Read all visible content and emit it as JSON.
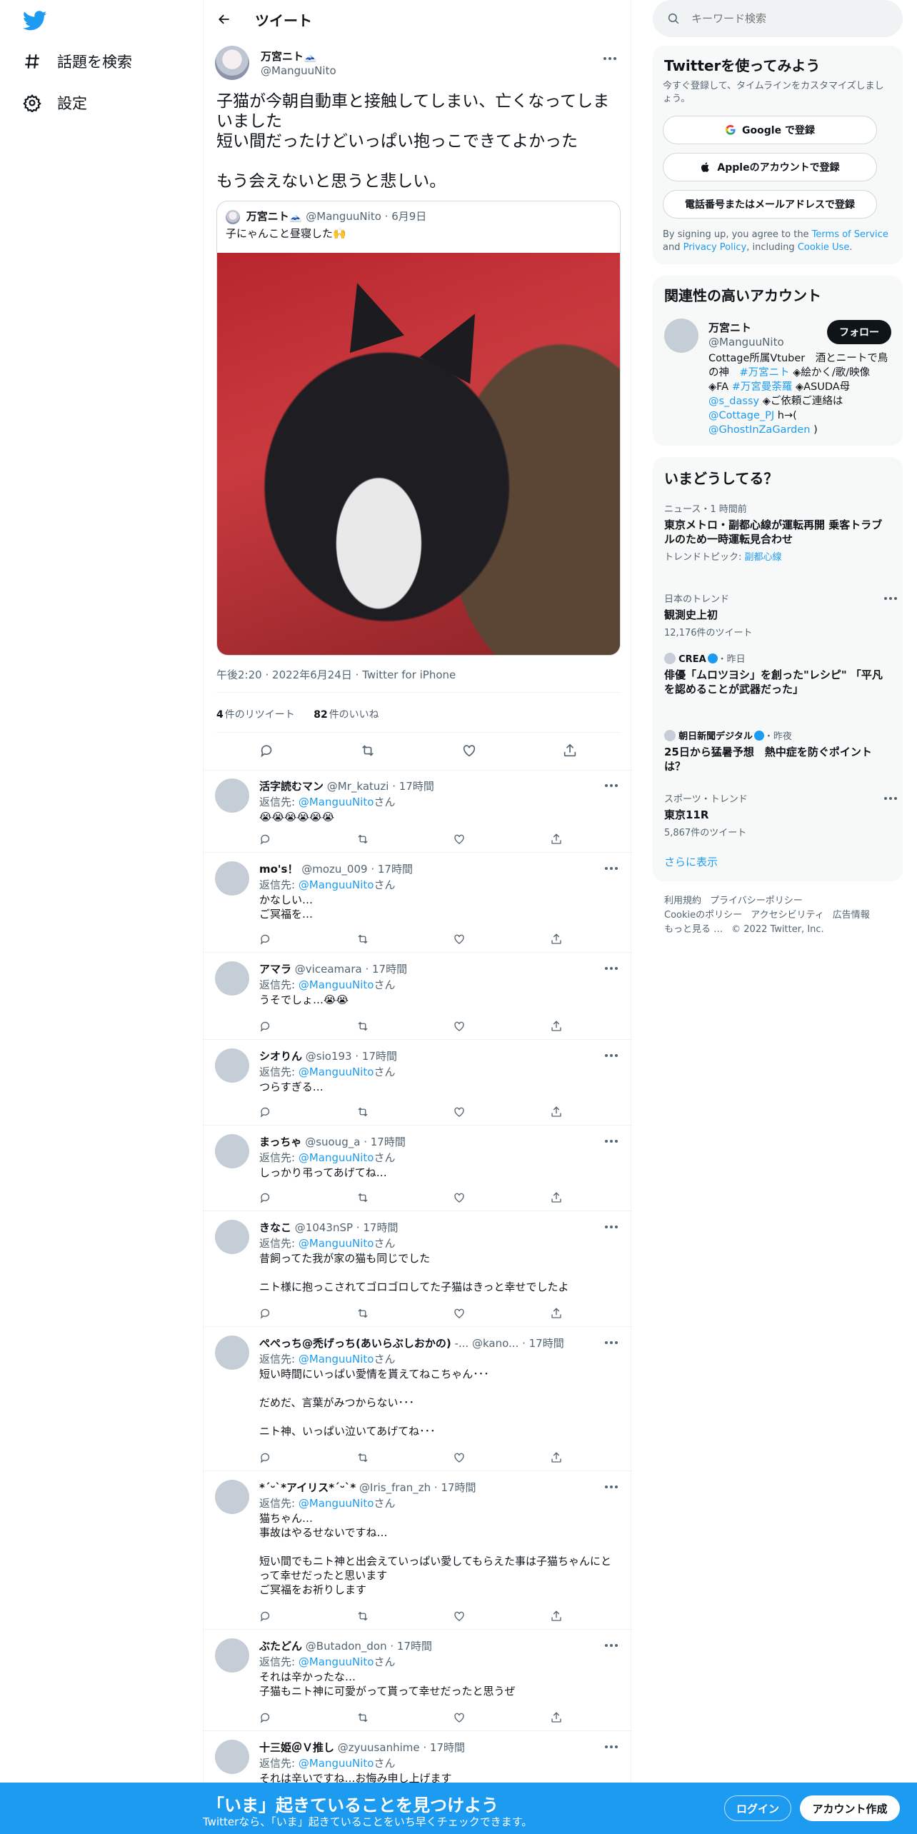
{
  "nav": {
    "explore_label": "話題を検索",
    "settings_label": "設定"
  },
  "header": {
    "title": "ツイート"
  },
  "main_tweet": {
    "name": "万宮ニト🗻",
    "handle": "@ManguuNito",
    "text": "子猫が今朝自動車と接触してしまい、亡くなってしまいました\n短い間だったけどいっぱい抱っこできてよかった\n\nもう会えないと思うと悲しい。",
    "quote": {
      "name": "万宮ニト🗻",
      "handle": "@ManguuNito",
      "date": "6月9日",
      "text": "子にゃんこと昼寝した🙌"
    },
    "time": "午後2:20",
    "date": "2022年6月24日",
    "source": "Twitter for iPhone",
    "retweets": "4",
    "retweets_label": "件のリツイート",
    "likes": "82",
    "likes_label": "件のいいね"
  },
  "replying_label": "返信先: ",
  "replying_suffix": "さん",
  "replies": [
    {
      "name": "活字読むマン",
      "handle": "@Mr_katuzi",
      "time": "17時間",
      "to": "@ManguuNito",
      "text": "😭😭😭😭😭😭"
    },
    {
      "name": "mo's！",
      "handle": "@mozu_009",
      "time": "17時間",
      "to": "@ManguuNito",
      "text": "かなしい…\nご冥福を…"
    },
    {
      "name": "アマラ",
      "handle": "@viceamara",
      "time": "17時間",
      "to": "@ManguuNito",
      "text": "うそでしょ…😭😭"
    },
    {
      "name": "シオりん",
      "handle": "@sio193",
      "time": "17時間",
      "to": "@ManguuNito",
      "text": "つらすぎる…"
    },
    {
      "name": "まっちゃ",
      "handle": "@suoug_a",
      "time": "17時間",
      "to": "@ManguuNito",
      "text": "しっかり弔ってあげてね…"
    },
    {
      "name": "きなこ",
      "handle": "@1043nSP",
      "time": "17時間",
      "to": "@ManguuNito",
      "text": "昔飼ってた我が家の猫も同じでした\n\nニト様に抱っこされてゴロゴロしてた子猫はきっと幸せでしたよ"
    },
    {
      "name": "ぺぺっち@禿げっち(あいらぶしおかの)",
      "handle": "-... @kano...",
      "time": "17時間",
      "to": "@ManguuNito",
      "text": "短い時間にいっぱい愛情を貰えてねこちゃん･･･\n\nだめだ、言葉がみつからない･･･\n\nニト神、いっぱい泣いてあげてね･･･"
    },
    {
      "name": "*ˊᵕˋ*アイリス*ˊᵕˋ*",
      "handle": "@Iris_fran_zh",
      "time": "17時間",
      "to": "@ManguuNito",
      "text": "猫ちゃん…\n事故はやるせないですね…\n\n短い間でもニト神と出会えていっぱい愛してもらえた事は子猫ちゃんにとって幸せだったと思います\nご冥福をお祈りします"
    },
    {
      "name": "ぶたどん",
      "handle": "@Butadon_don",
      "time": "17時間",
      "to": "@ManguuNito",
      "text": "それは辛かったな…\n子猫もニト神に可愛がって貰って幸せだったと思うぜ"
    },
    {
      "name": "十三姫＠Ｖ推し",
      "handle": "@zyuusanhime",
      "time": "17時間",
      "to": "@ManguuNito",
      "text": "それは辛いですね…お悔み申し上げます"
    }
  ],
  "sidebar": {
    "search_placeholder": "キーワード検索",
    "signup": {
      "title": "Twitterを使ってみよう",
      "desc": "今すぐ登録して、タイムラインをカスタマイズしましょう。",
      "google": "Google で登録",
      "apple": "Appleのアカウントで登録",
      "phone": "電話番号またはメールアドレスで登録",
      "terms_1": "By signing up, you agree to the ",
      "terms_link1": "Terms of Service",
      "terms_2": " and ",
      "terms_link2": "Privacy Policy",
      "terms_3": ", including ",
      "terms_link3": "Cookie Use",
      "terms_4": "."
    },
    "related": {
      "title": "関連性の高いアカウント",
      "name": "万宮ニト",
      "handle": "@ManguuNito",
      "follow": "フォロー",
      "bio_1": "Cottage所属Vtuber　酒とニートで鳥の神　",
      "bio_tag1": "#万宮ニト",
      "bio_2": " ◈絵かく/歌/映像 ◈FA ",
      "bio_tag2": "#万宮曼荼羅",
      "bio_3": " ◈ASUDA母 ",
      "bio_m1": "@s_dassy",
      "bio_4": " ◈ご依頼ご連絡は ",
      "bio_m2": "@Cottage_PJ",
      "bio_5": " h→( ",
      "bio_m3": "@GhostInZaGarden",
      "bio_6": " )"
    },
    "trends": {
      "title": "いまどうしてる？",
      "items": [
        {
          "cat": "ニュース・1 時間前",
          "title": "東京メトロ・副都心線が運転再開 乗客トラブルのため一時運転見合わせ",
          "sub_label": "トレンドトピック: ",
          "sub_link": "副都心線"
        },
        {
          "cat": "日本のトレンド",
          "title": "観測史上初",
          "sub": "12,176件のツイート"
        },
        {
          "source": "CREA",
          "age": "・昨日",
          "title": "俳優「ムロツヨシ」を創った\"レシピ\" 「平凡を認めることが武器だった」"
        },
        {
          "source": "朝日新聞デジタル",
          "age": "・昨夜",
          "title": "25日から猛暑予想　熱中症を防ぐポイントは？"
        },
        {
          "cat": "スポーツ・トレンド",
          "title": "東京11R",
          "sub": "5,867件のツイート"
        }
      ],
      "show_more": "さらに表示"
    },
    "footer": [
      "利用規約",
      "プライバシーポリシー",
      "Cookieのポリシー",
      "アクセシビリティ",
      "広告情報",
      "もっと見る …",
      "© 2022 Twitter, Inc."
    ]
  },
  "bottom_bar": {
    "title": "「いま」起きていることを見つけよう",
    "sub": "Twitterなら、「いま」起きていることをいち早くチェックできます。",
    "login": "ログイン",
    "signup": "アカウント作成"
  },
  "colors": {
    "accent": "#1d9bf0",
    "text": "#0f1419",
    "muted": "#536471"
  }
}
